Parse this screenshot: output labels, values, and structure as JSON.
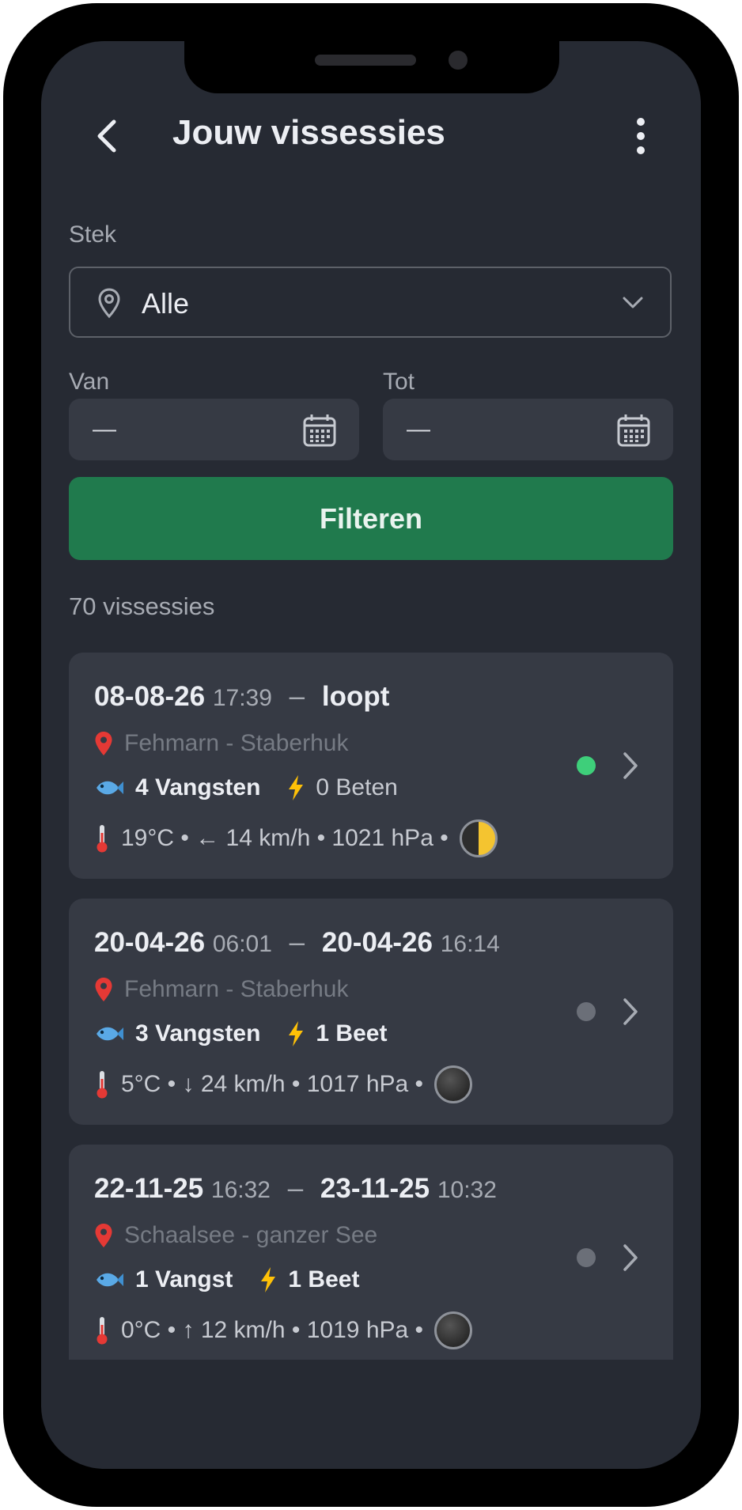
{
  "header": {
    "title": "Jouw vissessies"
  },
  "filters": {
    "stek_label": "Stek",
    "stek_value": "Alle",
    "van_label": "Van",
    "van_value": "—",
    "tot_label": "Tot",
    "tot_value": "—",
    "filter_button": "Filteren"
  },
  "session_count": "70 vissessies",
  "sessions": [
    {
      "start_date": "08-08-26",
      "start_time": "17:39",
      "sep": "–",
      "end_date": "loopt",
      "end_time": "",
      "location": "Fehmarn - Staberhuk",
      "catches": "4 Vangsten",
      "bites": "0 Beten",
      "weather": "19°C • ← 14 km/h • 1021 hPa •",
      "status": "active",
      "status_color": "#3ecf7a",
      "moon": "first-quarter"
    },
    {
      "start_date": "20-04-26",
      "start_time": "06:01",
      "sep": "–",
      "end_date": "20-04-26",
      "end_time": "16:14",
      "location": "Fehmarn - Staberhuk",
      "catches": "3 Vangsten",
      "bites": "1 Beet",
      "weather": "5°C • ↓ 24 km/h • 1017 hPa •",
      "status": "ended",
      "status_color": "#6b6f78",
      "moon": "new-moon"
    },
    {
      "start_date": "22-11-25",
      "start_time": "16:32",
      "sep": "–",
      "end_date": "23-11-25",
      "end_time": "10:32",
      "location": "Schaalsee - ganzer See",
      "catches": "1 Vangst",
      "bites": "1 Beet",
      "weather": "0°C • ↑ 12 km/h • 1019 hPa •",
      "status": "ended",
      "status_color": "#6b6f78",
      "moon": "new-moon"
    }
  ],
  "colors": {
    "accent": "#207a4d",
    "background": "#262a33",
    "card": "#363a44"
  }
}
